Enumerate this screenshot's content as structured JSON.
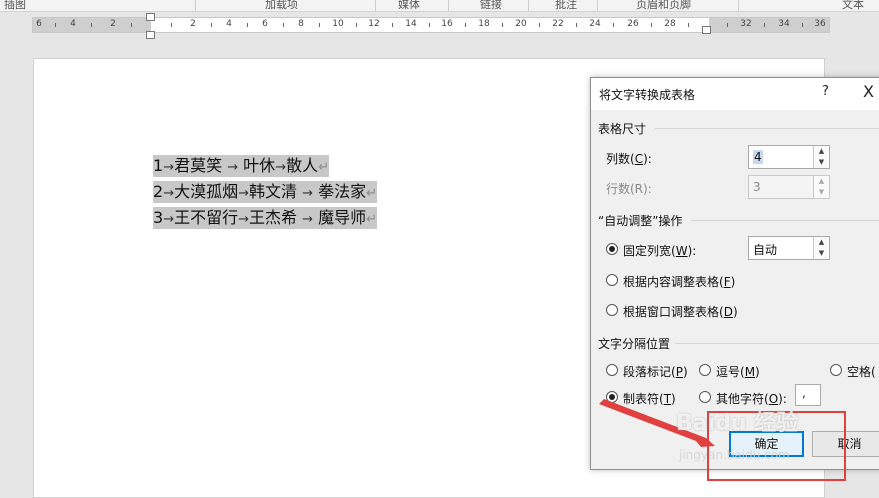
{
  "ribbon": {
    "groups": [
      "插图",
      "加载项",
      "媒体",
      "链接",
      "批注",
      "页眉和页脚",
      "文本"
    ]
  },
  "ruler": {
    "labels": [
      "6",
      "4",
      "2",
      "2",
      "4",
      "6",
      "8",
      "10",
      "12",
      "14",
      "16",
      "18",
      "20",
      "22",
      "24",
      "26",
      "28",
      "32",
      "34",
      "36"
    ]
  },
  "document": {
    "lines": [
      {
        "c1": "1",
        "c2": "君莫笑 ",
        "c3": " 叶休",
        "c4": "散人"
      },
      {
        "c1": "2",
        "c2": "大漠孤烟",
        "c3": "韩文清 ",
        "c4": " 拳法家"
      },
      {
        "c1": "3",
        "c2": "王不留行",
        "c3": "王杰希 ",
        "c4": " 魔导师"
      }
    ],
    "tab_glyph": "→",
    "para_mark": "↵"
  },
  "dialog": {
    "title": "将文字转换成表格",
    "help": "?",
    "close": "X",
    "table_size": {
      "label": "表格尺寸",
      "columns_label": "列数(",
      "columns_key": "C",
      "columns_suffix": "):",
      "columns_value": "4",
      "rows_label": "行数(R):",
      "rows_value": "3"
    },
    "autofit": {
      "label": "“自动调整”操作",
      "fixed_label": "固定列宽(",
      "fixed_key": "W",
      "fixed_suffix": "):",
      "fixed_value": "自动",
      "contents_label": "根据内容调整表格(",
      "contents_key": "F",
      "contents_suffix": ")",
      "window_label": "根据窗口调整表格(",
      "window_key": "D",
      "window_suffix": ")"
    },
    "separator": {
      "label": "文字分隔位置",
      "para_label": "段落标记(",
      "para_key": "P",
      "comma_label": "逗号(",
      "comma_key": "M",
      "space_label": "空格(",
      "tab_label": "制表符(",
      "tab_key": "T",
      "other_label": "其他字符(",
      "other_key": "O",
      "other_suffix": "):",
      "other_value": ",",
      "close_paren": ")"
    },
    "ok": "确定",
    "cancel": "取消"
  },
  "overlay": {
    "watermark": "Baidu 经验",
    "watermark_url": "jingyan.baidu.com"
  },
  "colors": {
    "annotation_red": "#e04040",
    "default_button_border": "#0078d7"
  }
}
